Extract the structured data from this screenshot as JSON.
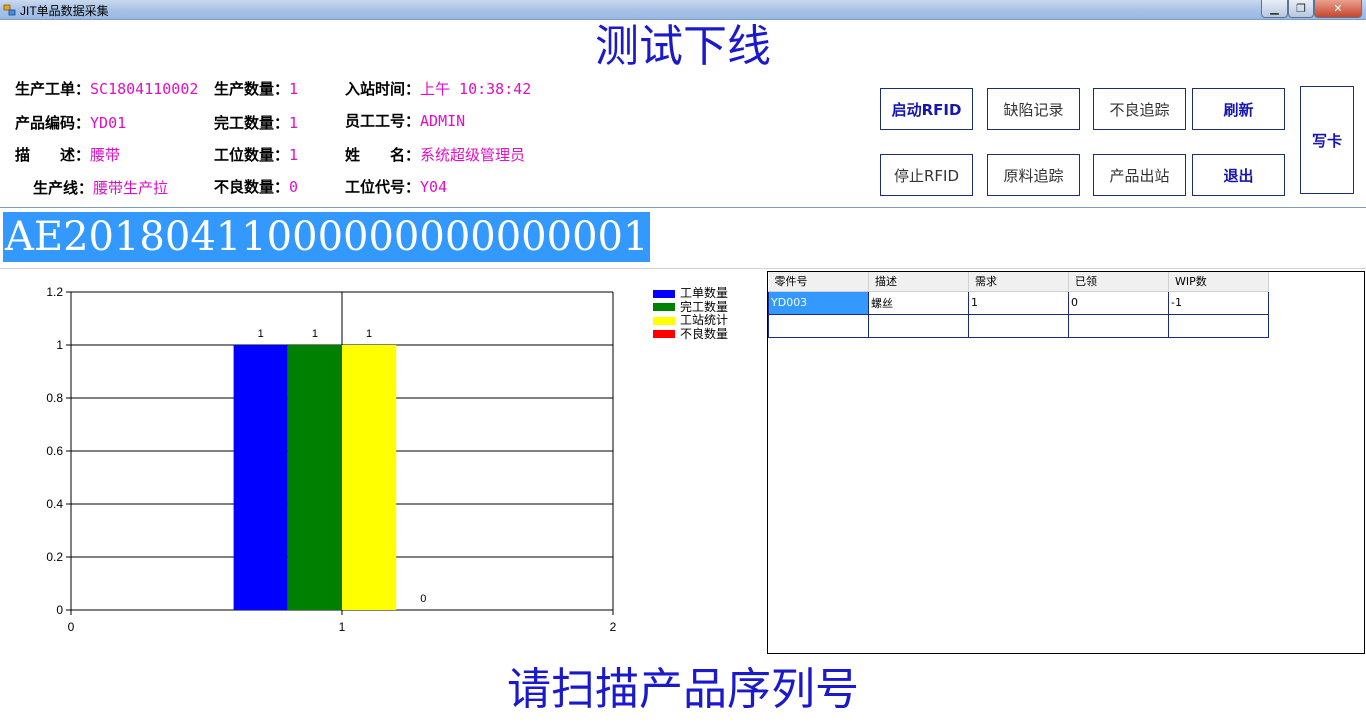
{
  "window": {
    "title": "JIT单品数据采集"
  },
  "header": {
    "title": "测试下线"
  },
  "info": {
    "work_order_label": "生产工单：",
    "work_order": "SC1804110002",
    "prod_qty_label": "生产数量：",
    "prod_qty": "1",
    "in_time_label": "入站时间：",
    "in_time": "上午 10:38:42",
    "product_code_label": "产品编码：",
    "product_code": "YD01",
    "done_qty_label": "完工数量：",
    "done_qty": "1",
    "employee_id_label": "员工工号：",
    "employee_id": "ADMIN",
    "desc_label": "描　　述：",
    "desc": "腰带",
    "station_qty_label": "工位数量：",
    "station_qty": "1",
    "name_label": "姓　　名：",
    "name": "系统超级管理员",
    "line_label": "生产线：",
    "line": "腰带生产拉",
    "defect_qty_label": "不良数量：",
    "defect_qty": "0",
    "station_code_label": "工位代号：",
    "station_code": "Y04"
  },
  "buttons": {
    "start_rfid": "启动RFID",
    "defect_record": "缺陷记录",
    "bad_trace": "不良追踪",
    "refresh": "刷新",
    "stop_rfid": "停止RFID",
    "material_trace": "原料追踪",
    "product_out": "产品出站",
    "exit": "退出",
    "write_card": "写卡"
  },
  "serial": {
    "value": "AE20180411000000000000001"
  },
  "parts_grid": {
    "headers": [
      "零件号",
      "描述",
      "需求",
      "已领",
      "WIP数"
    ],
    "rows": [
      [
        "YD003",
        "螺丝",
        "1",
        "0",
        "-1"
      ],
      [
        "",
        "",
        "",
        "",
        ""
      ]
    ]
  },
  "chart_data": {
    "type": "bar",
    "x": [
      1
    ],
    "xlim": [
      0,
      2
    ],
    "ylim": [
      0,
      1.2
    ],
    "xticks": [
      "0",
      "1",
      "2"
    ],
    "yticks": [
      "0",
      "0.2",
      "0.4",
      "0.6",
      "0.8",
      "1",
      "1.2"
    ],
    "grid": true,
    "legend_position": "right",
    "series": [
      {
        "name": "工单数量",
        "values": [
          1
        ],
        "color": "#0000ff",
        "label": "1"
      },
      {
        "name": "完工数量",
        "values": [
          1
        ],
        "color": "#008000",
        "label": "1"
      },
      {
        "name": "工站统计",
        "values": [
          1
        ],
        "color": "#ffff00",
        "label": "1"
      },
      {
        "name": "不良数量",
        "values": [
          0
        ],
        "color": "#ff0000",
        "label": "0"
      }
    ]
  },
  "status": {
    "prompt": "请扫描产品序列号"
  }
}
